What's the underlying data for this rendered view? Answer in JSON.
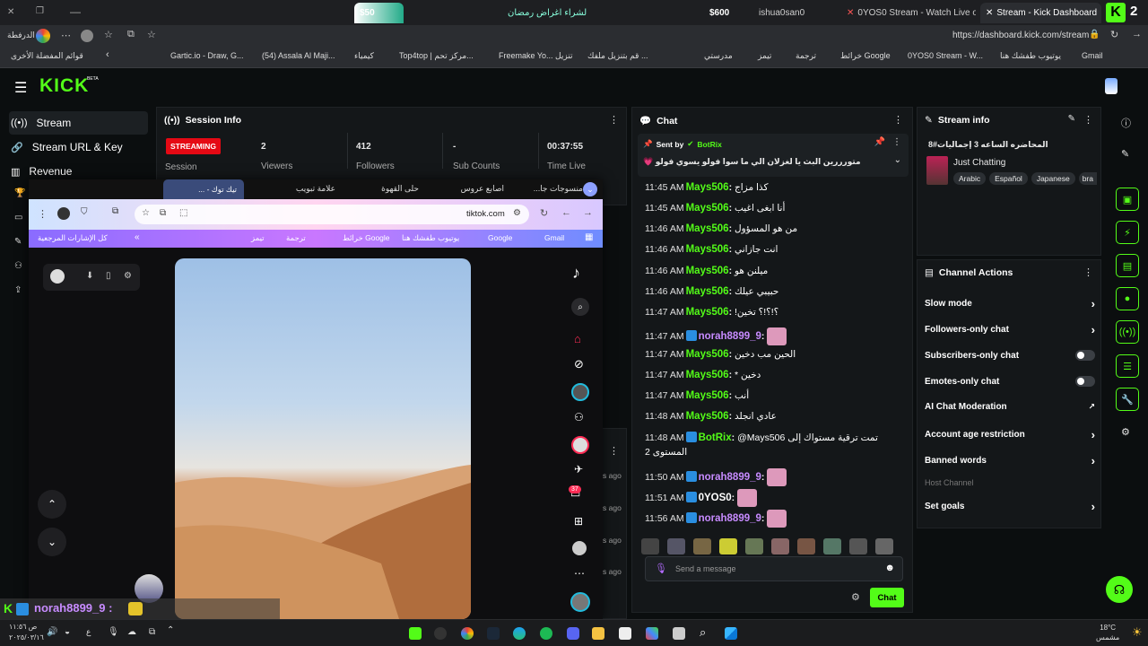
{
  "browser": {
    "tabs": [
      {
        "label": "Stream - Kick Dashboard",
        "active": true
      },
      {
        "label": "0YOS0 Stream - Watch Live on Kick",
        "active": false
      },
      {
        "label": "ishua0san0",
        "active": false
      },
      {
        "label": "$600",
        "active": false
      },
      {
        "label": "لشراء اغراض رمضان",
        "active": false
      },
      {
        "label": "$50",
        "active": false
      }
    ],
    "url": "https://dashboard.kick.com/stream",
    "left_label": "الدرفطة",
    "bookmarks": [
      "Gmail",
      "يوتيوب طفشك هنا",
      "0YOS0 Stream - W...",
      "خرائط Google",
      "ترجمة",
      "تيمز",
      "مدرستي",
      "قم بتنزيل ملفك ...",
      "Freemake Yo... تنزيل",
      "Top4top | مركز تحم...",
      "كيمياء",
      "(54) Assala Al Maji...",
      "Gartic.io - Draw, G...",
      "قوائم المفضلة الأخرى"
    ]
  },
  "kick": {
    "logo": "KICK",
    "logo_badge": "BETA",
    "nav": [
      {
        "label": "Stream",
        "icon": "broadcast-icon"
      },
      {
        "label": "Stream URL & Key",
        "icon": "link-icon"
      },
      {
        "label": "Revenue",
        "icon": "chart-icon"
      }
    ],
    "session": {
      "title": "Session Info",
      "status": "STREAMING",
      "status_sub": "Session",
      "stats": [
        {
          "value": "2",
          "label": "Viewers"
        },
        {
          "value": "412",
          "label": "Followers"
        },
        {
          "value": "-",
          "label": "Sub Counts"
        },
        {
          "value": "00:37:55",
          "label": "Time Live"
        }
      ]
    },
    "chat": {
      "title": "Chat",
      "pinned_by_label": "Sent by",
      "pinned_by_user": "BotRix",
      "pinned_text": "متورررين البث يا لغزلان الي ما سوا فولو يسوي فولو 💗",
      "messages": [
        {
          "time": "11:45 AM",
          "user": "Mays506",
          "color": "#53fc18",
          "text": "كذا مزاج"
        },
        {
          "time": "11:45 AM",
          "user": "Mays506",
          "color": "#53fc18",
          "text": "أنا ابغى اغيب"
        },
        {
          "time": "11:46 AM",
          "user": "Mays506",
          "color": "#53fc18",
          "text": "من هو المسؤول"
        },
        {
          "time": "11:46 AM",
          "user": "Mays506",
          "color": "#53fc18",
          "text": "انت جازاني"
        },
        {
          "time": "11:46 AM",
          "user": "Mays506",
          "color": "#53fc18",
          "text": "ميلنن هو"
        },
        {
          "time": "11:46 AM",
          "user": "Mays506",
          "color": "#53fc18",
          "text": "حبيبي عيلك"
        },
        {
          "time": "11:47 AM",
          "user": "Mays506",
          "color": "#53fc18",
          "text": "!؟!؟!؟ تخين"
        },
        {
          "time": "11:47 AM",
          "user": "norah8899_9",
          "color": "#c78bff",
          "text": ""
        },
        {
          "time": "11:47 AM",
          "user": "Mays506",
          "color": "#53fc18",
          "text": "الحين مب دخين"
        },
        {
          "time": "11:47 AM",
          "user": "Mays506",
          "color": "#53fc18",
          "text": "* دخين"
        },
        {
          "time": "11:47 AM",
          "user": "Mays506",
          "color": "#53fc18",
          "text": "أنب"
        },
        {
          "time": "11:48 AM",
          "user": "Mays506",
          "color": "#53fc18",
          "text": "عادي انجلد"
        },
        {
          "time": "11:48 AM",
          "user": "BotRix",
          "color": "#53fc18",
          "text": "@Mays506 تمت ترقية مستواك إلى"
        },
        {
          "time": "",
          "user": "",
          "color": "#ffffff",
          "text": "المستوى 2"
        },
        {
          "time": "11:50 AM",
          "user": "norah8899_9",
          "color": "#c78bff",
          "text": ""
        },
        {
          "time": "11:51 AM",
          "user": "0YOS0",
          "color": "#ffffff",
          "text": ""
        },
        {
          "time": "11:56 AM",
          "user": "norah8899_9",
          "color": "#c78bff",
          "text": ""
        }
      ],
      "input_placeholder": "Send a message",
      "send_label": "Chat"
    },
    "stream_info": {
      "title": "Stream info",
      "stream_title": "المحاضره الساعه 3 إجماليات#8",
      "category": "Just Chatting",
      "tags": [
        "Arabic",
        "Español",
        "Japanese",
        "bra"
      ]
    },
    "channel_actions": {
      "title": "Channel Actions",
      "items": [
        {
          "label": "Slow mode",
          "control": "arrow"
        },
        {
          "label": "Followers-only chat",
          "control": "arrow"
        },
        {
          "label": "Subscribers-only chat",
          "control": "toggle"
        },
        {
          "label": "Emotes-only chat",
          "control": "toggle"
        },
        {
          "label": "AI Chat Moderation",
          "control": "external"
        },
        {
          "label": "Account age restriction",
          "control": "arrow"
        },
        {
          "label": "Banned words",
          "control": "arrow"
        }
      ],
      "host_label": "Host Channel",
      "goals_label": "Set goals"
    }
  },
  "tiktok_window": {
    "tabs": [
      "منسوجات جا...",
      "اصابع عروس",
      "حلى القهوة",
      "علامة تبويب",
      "تيك توك - ..."
    ],
    "url": "tiktok.com",
    "bookmarks": [
      "كل الإشارات المرجعية",
      "Gmail",
      "Google",
      "يوتيوب طفشك هنا",
      "خرائط Google",
      "ترجمة",
      "تيمز"
    ],
    "side_labels": [
      "s ago",
      "s ago",
      "s ago",
      "s ago"
    ],
    "notif_count": "37"
  },
  "overlay_chat": {
    "user": "norah8899_9 :"
  },
  "taskbar": {
    "time": "ص ١١:٥٦",
    "date": "٢٠٢٥/٠٣/١٦",
    "weather_temp": "18°C",
    "weather_label": "مشمس"
  }
}
